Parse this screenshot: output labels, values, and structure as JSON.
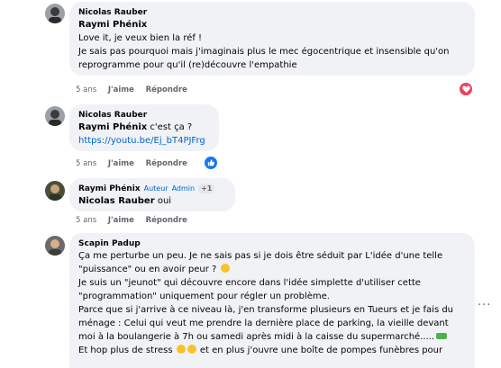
{
  "comments": [
    {
      "author": "Nicolas Rauber",
      "mention": "Raymi Phénix",
      "lines": [
        "Love it, je veux bien la réf !",
        "Je sais pas pourquoi mais j'imaginais plus le mec égocentrique et insensible qu'on",
        "reprogramme pour qu'il (re)découvre l'empathie"
      ],
      "time": "5 ans",
      "like": "J'aime",
      "reply": "Répondre",
      "reaction": "love-icon"
    },
    {
      "author": "Nicolas Rauber",
      "mention": "Raymi Phénix",
      "text": " c'est ça ?",
      "link": "https://youtu.be/Ej_bT4PJFrg",
      "time": "5 ans",
      "like": "J'aime",
      "reply": "Répondre",
      "reaction": "like-icon"
    },
    {
      "author": "Raymi Phénix",
      "badge_author": "Auteur",
      "badge_admin": "Admin",
      "badge_count": "+1",
      "mention": "Nicolas Rauber",
      "text": " oui",
      "time": "5 ans",
      "like": "J'aime",
      "reply": "Répondre"
    },
    {
      "author": "Scapin Padup",
      "lines": [
        "Ça me perturbe un peu. Je ne sais pas si je dois être séduit par L'idée d'une telle",
        "\"puissance\" ou en avoir peur ?",
        "Je suis un \"jeunot\" qui découvre encore dans l'idée simplette d'utiliser cette",
        "\"programmation\" uniquement pour régler un problème.",
        "Parce que si j'arrive à ce niveau là, j'en transforme plusieurs en Tueurs et je fais du",
        "ménage : Celui qui veut me prendre la dernière place de parking, la vieille devant",
        "moi à la boulangerie à 7h ou samedi après midi à la caisse du supermarché.....",
        "Et hop plus de stress",
        " et en plus j'ouvre une boîte de pompes funèbres pour"
      ],
      "dots": "···"
    }
  ],
  "colors": {
    "bubble": "#f0f2f5",
    "link": "#0064d1",
    "love": "#f33e58",
    "like": "#1877f2"
  }
}
